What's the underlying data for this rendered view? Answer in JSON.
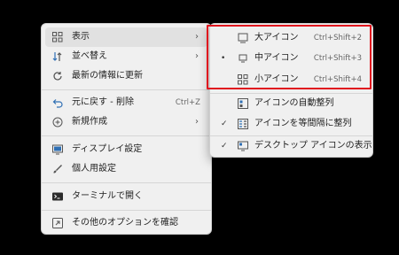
{
  "menu": {
    "items": [
      {
        "label": "表示",
        "icon": "grid-icon",
        "arrow": "›"
      },
      {
        "label": "並べ替え",
        "icon": "sort-icon",
        "arrow": "›"
      },
      {
        "label": "最新の情報に更新",
        "icon": "refresh-icon"
      },
      {
        "label": "元に戻す - 削除",
        "icon": "undo-icon",
        "shortcut": "Ctrl+Z"
      },
      {
        "label": "新規作成",
        "icon": "new-icon",
        "arrow": "›"
      },
      {
        "label": "ディスプレイ設定",
        "icon": "display-icon"
      },
      {
        "label": "個人用設定",
        "icon": "brush-icon"
      },
      {
        "label": "ターミナルで開く",
        "icon": "terminal-icon"
      },
      {
        "label": "その他のオプションを確認",
        "icon": "more-options-icon"
      }
    ]
  },
  "submenu": {
    "items": [
      {
        "label": "大アイコン",
        "icon": "large-icons-icon",
        "shortcut": "Ctrl+Shift+2",
        "mark": ""
      },
      {
        "label": "中アイコン",
        "icon": "medium-icons-icon",
        "shortcut": "Ctrl+Shift+3",
        "mark": "•"
      },
      {
        "label": "小アイコン",
        "icon": "small-icons-icon",
        "shortcut": "Ctrl+Shift+4",
        "mark": ""
      },
      {
        "label": "アイコンの自動整列",
        "icon": "auto-arrange-icon",
        "mark": ""
      },
      {
        "label": "アイコンを等間隔に整列",
        "icon": "align-grid-icon",
        "mark": "✓"
      },
      {
        "label": "デスクトップ アイコンの表示",
        "icon": "desktop-icons-icon",
        "mark": "✓"
      }
    ]
  },
  "colors": {
    "highlight": "#e0141e",
    "accent": "#2f6fb4"
  }
}
